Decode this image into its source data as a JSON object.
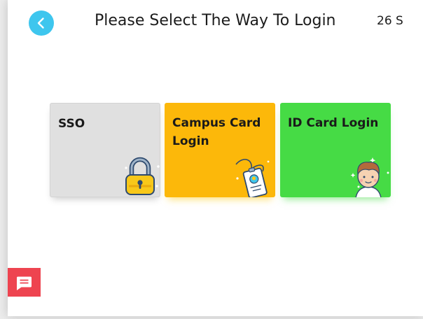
{
  "header": {
    "title": "Please Select The Way To Login",
    "countdown": "26 S",
    "back_icon": "chevron-left-icon"
  },
  "login_options": [
    {
      "label": "SSO",
      "icon": "padlock-icon",
      "color": "#e0e0e0"
    },
    {
      "label": "Campus Card Login",
      "icon": "id-badge-icon",
      "color": "#fcb80a"
    },
    {
      "label": "ID Card Login",
      "icon": "person-face-icon",
      "color": "#46db45"
    }
  ],
  "feedback": {
    "icon": "message-icon",
    "color": "#ee4450"
  },
  "colors": {
    "accent": "#3ec6ee"
  }
}
